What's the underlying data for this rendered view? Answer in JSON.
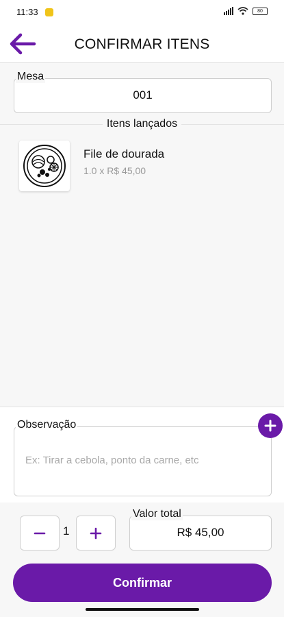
{
  "status_bar": {
    "time": "11:33",
    "battery": "80"
  },
  "header": {
    "title": "CONFIRMAR ITENS",
    "back_icon": "arrow-left-icon"
  },
  "mesa": {
    "label": "Mesa",
    "value": "001"
  },
  "items_section": {
    "title": "Itens lançados",
    "items": [
      {
        "name": "File de dourada",
        "detail": "1.0 x R$ 45,00",
        "icon": "dish-plate-icon"
      }
    ]
  },
  "observacao": {
    "label": "Observação",
    "placeholder": "Ex: Tirar a cebola, ponto da carne, etc",
    "value": ""
  },
  "quantity": {
    "value": "1",
    "decrement_icon": "minus-icon",
    "increment_icon": "plus-icon"
  },
  "total": {
    "label": "Valor total",
    "value": "R$ 45,00"
  },
  "confirm_button": {
    "label": "Confirmar"
  },
  "colors": {
    "accent": "#6a1aa8",
    "border": "#cfcfcf",
    "muted_text": "#9a9a9a"
  }
}
